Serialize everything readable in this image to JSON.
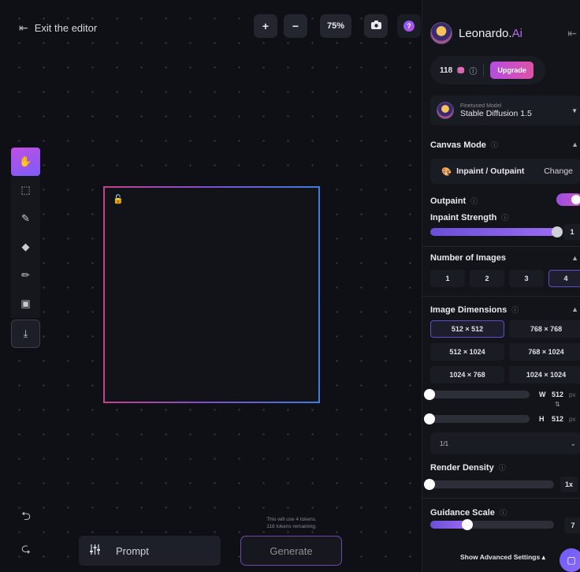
{
  "header": {
    "exit_label": "Exit the editor",
    "zoom_in": "+",
    "zoom_out": "−",
    "zoom_level": "75%",
    "help": "?"
  },
  "canvas": {
    "token_note_line1": "This will use 4 tokens.",
    "token_note_line2": "118 tokens remaining."
  },
  "prompt": {
    "label": "Prompt"
  },
  "generate": {
    "label": "Generate"
  },
  "panel": {
    "brand_name": "Leonardo.",
    "brand_suffix": "Ai",
    "credits": "118",
    "upgrade_label": "Upgrade",
    "model_sub": "Finetuned Model",
    "model_name": "Stable Diffusion 1.5",
    "canvas_mode_title": "Canvas Mode",
    "canvas_mode_value": "Inpaint / Outpaint",
    "canvas_mode_change": "Change",
    "outpaint_label": "Outpaint",
    "outpaint_on": true,
    "inpaint_strength_label": "Inpaint Strength",
    "inpaint_strength_value": "1",
    "inpaint_strength_fraction": 0.97,
    "num_images_title": "Number of Images",
    "num_images_options": [
      "1",
      "2",
      "3",
      "4"
    ],
    "num_images_selected": "4",
    "dims_title": "Image Dimensions",
    "dims_options": [
      "512 × 512",
      "768 × 768",
      "512 × 1024",
      "768 × 1024",
      "1024 × 768",
      "1024 × 1024"
    ],
    "dims_selected": "512 × 512",
    "width_label": "W",
    "width_value": "512",
    "height_label": "H",
    "height_value": "512",
    "unit": "px",
    "swap_glyph": "⇅",
    "ratio": "1/1",
    "render_density_label": "Render Density",
    "render_density_value": "1x",
    "render_density_fraction": 0.0,
    "guidance_label": "Guidance Scale",
    "guidance_value": "7",
    "guidance_fraction": 0.3,
    "advanced_label": "Show Advanced Settings"
  },
  "colors": {
    "accent_purple": "#9a4fe0",
    "accent_pink": "#e052a5",
    "canvas_bg": "#0e1015",
    "panel_bg": "#121419"
  },
  "icons": [
    "back-arrow-icon",
    "camera-icon",
    "help-icon",
    "hand-icon",
    "select-icon",
    "brush-fill-icon",
    "eraser-icon",
    "pencil-icon",
    "image-icon",
    "download-icon",
    "lock-icon",
    "undo-icon",
    "redo-icon",
    "sliders-icon",
    "coin-icon",
    "palette-icon",
    "chat-icon"
  ]
}
